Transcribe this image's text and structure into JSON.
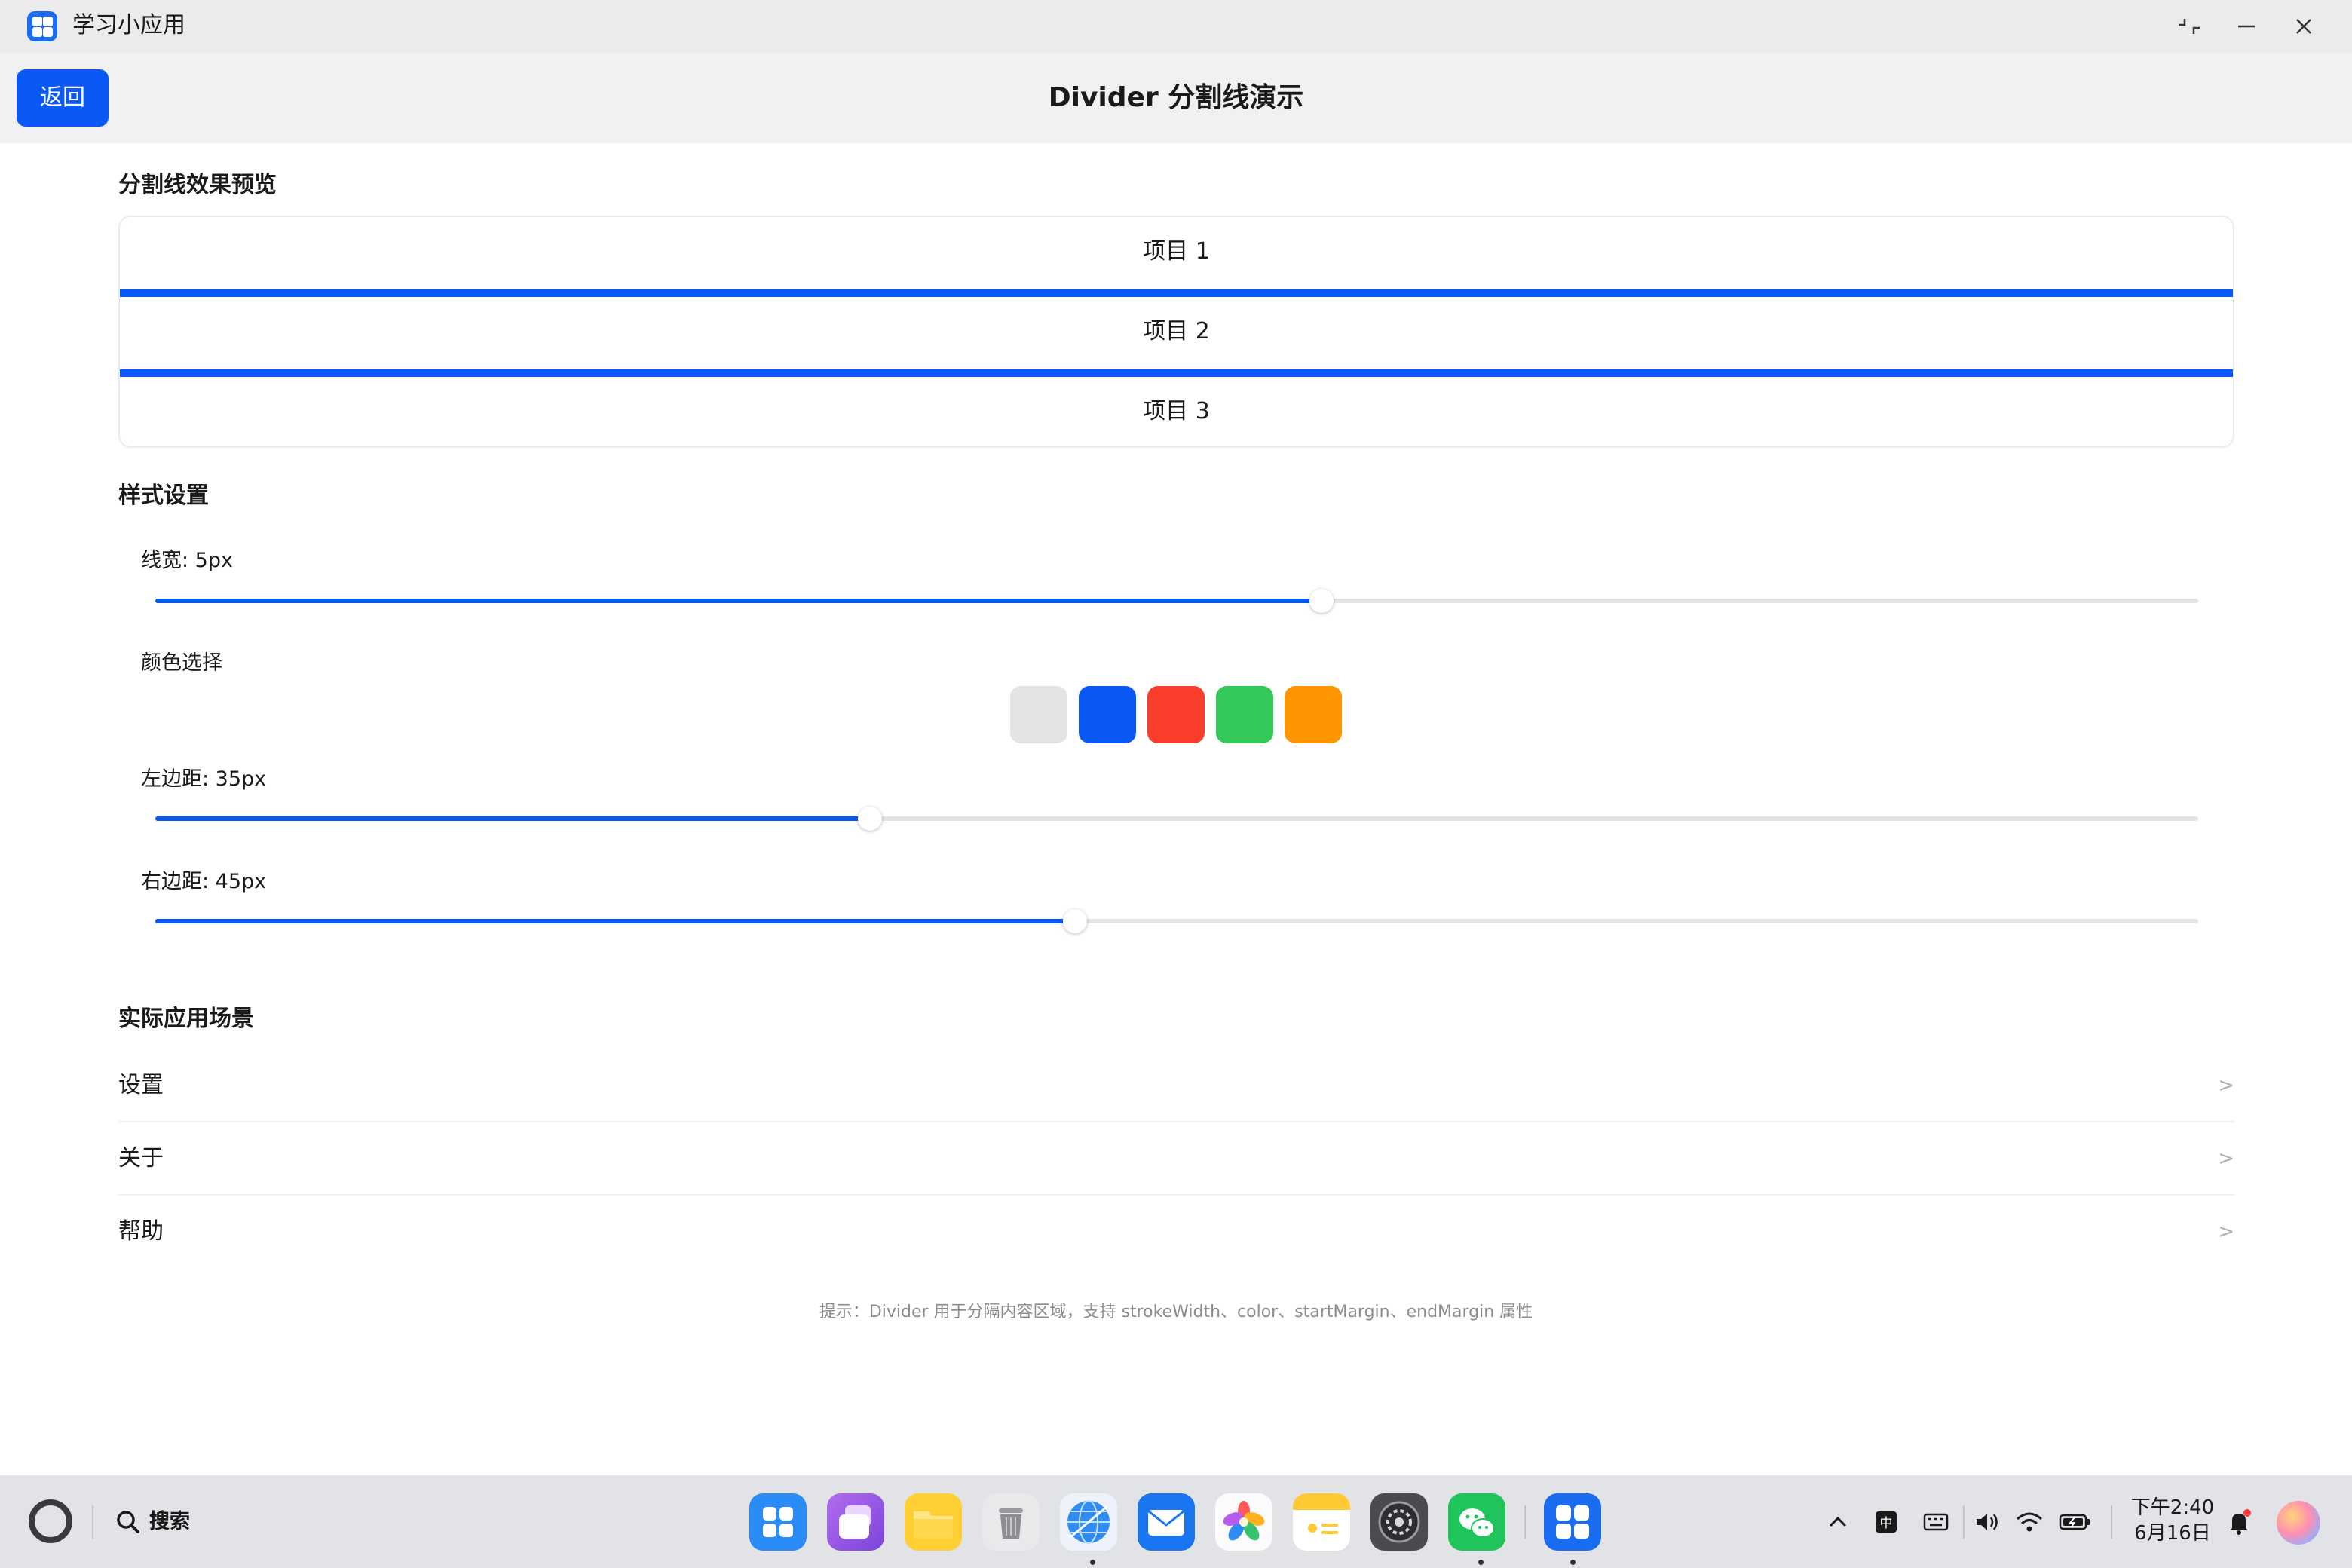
{
  "window": {
    "title": "学习小应用",
    "icon": "grid-app-icon",
    "controls": [
      "restore-icon",
      "minimize-icon",
      "close-icon"
    ]
  },
  "header": {
    "back_label": "返回",
    "title": "Divider 分割线演示"
  },
  "preview": {
    "section_title": "分割线效果预览",
    "items": [
      "项目 1",
      "项目 2",
      "项目 3"
    ],
    "divider_color": "#0a59f7"
  },
  "style": {
    "section_title": "样式设置",
    "stroke_width": {
      "label": "线宽: 5px",
      "value": 5,
      "fraction": 0.571
    },
    "color": {
      "label": "颜色选择",
      "options": [
        "#e4e4e4",
        "#0a59f7",
        "#fa3e2c",
        "#34c759",
        "#ff9500"
      ],
      "selected": "#0a59f7"
    },
    "start_margin": {
      "label": "左边距: 35px",
      "value": 35,
      "fraction": 0.35
    },
    "end_margin": {
      "label": "右边距: 45px",
      "value": 45,
      "fraction": 0.45
    }
  },
  "scenarios": {
    "section_title": "实际应用场景",
    "items": [
      {
        "label": "设置",
        "chevron": ">"
      },
      {
        "label": "关于",
        "chevron": ">"
      },
      {
        "label": "帮助",
        "chevron": ">"
      }
    ]
  },
  "hint": "提示：Divider 用于分隔内容区域，支持 strokeWidth、color、startMargin、endMargin 属性",
  "taskbar": {
    "search_label": "搜索",
    "dock_apps": [
      "app-grid-icon",
      "multitask-icon",
      "files-icon",
      "trash-icon",
      "browser-icon",
      "mail-icon",
      "gallery-icon",
      "notes-icon",
      "settings-icon",
      "wechat-icon",
      "learning-app-icon"
    ],
    "tray": {
      "ime": "中",
      "time": "下午2:40",
      "date": "6月16日"
    }
  }
}
